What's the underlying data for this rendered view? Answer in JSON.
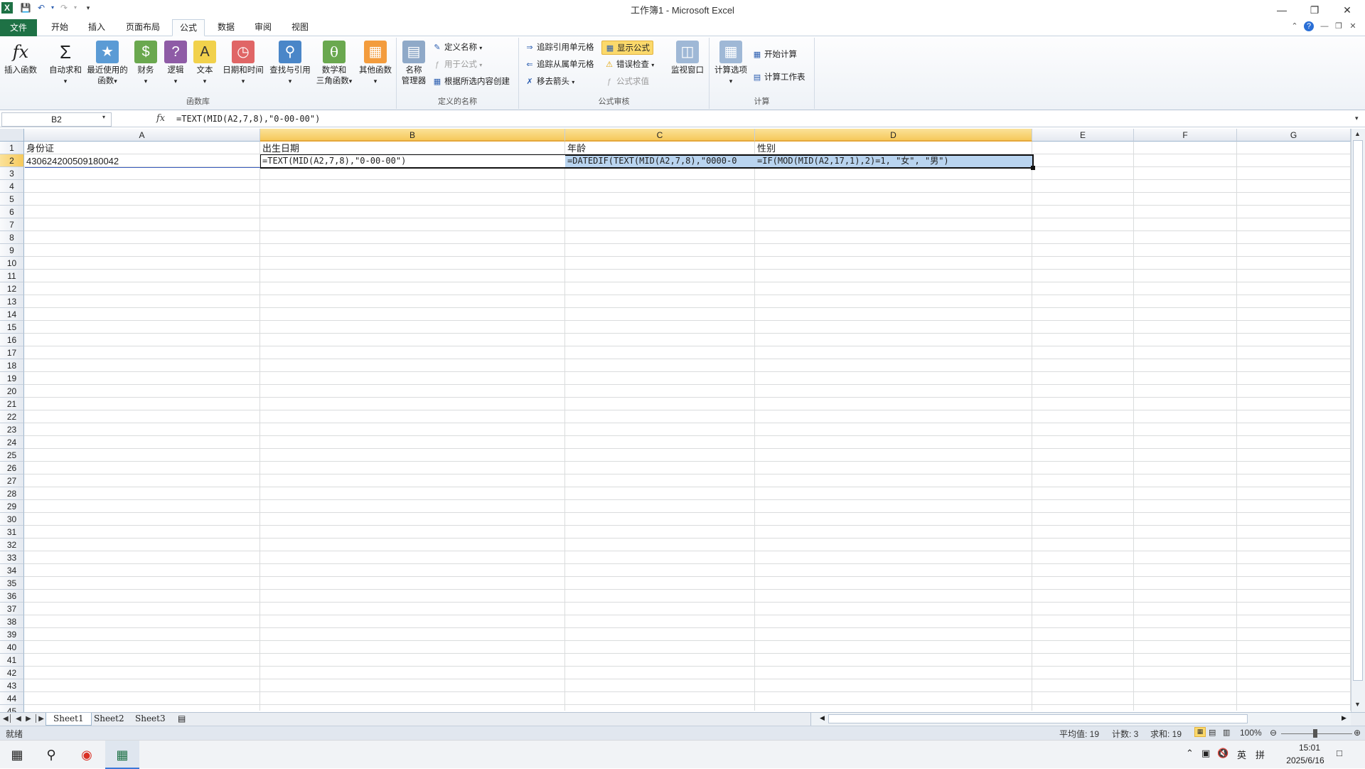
{
  "window": {
    "title": "工作簿1 - Microsoft Excel"
  },
  "tabs": [
    {
      "label": "文件"
    },
    {
      "label": "开始"
    },
    {
      "label": "插入"
    },
    {
      "label": "页面布局"
    },
    {
      "label": "公式"
    },
    {
      "label": "数据"
    },
    {
      "label": "审阅"
    },
    {
      "label": "视图"
    }
  ],
  "ribbon": {
    "function_library": {
      "label": "函数库",
      "insert_function": "插入函数",
      "autosum": "自动求和",
      "recent_1": "最近使用的",
      "recent_2": "函数",
      "financial": "财务",
      "logical": "逻辑",
      "text": "文本",
      "datetime": "日期和时间",
      "lookup": "查找与引用",
      "math_1": "数学和",
      "math_2": "三角函数",
      "more": "其他函数"
    },
    "defined_names": {
      "label": "定义的名称",
      "name_manager_1": "名称",
      "name_manager_2": "管理器",
      "define_name": "定义名称",
      "use_in_formula": "用于公式",
      "create_from_selection": "根据所选内容创建"
    },
    "formula_auditing": {
      "label": "公式审核",
      "trace_precedents": "追踪引用单元格",
      "trace_dependents": "追踪从属单元格",
      "remove_arrows": "移去箭头",
      "show_formulas": "显示公式",
      "error_checking": "错误检查",
      "evaluate_formula": "公式求值",
      "watch_window": "监视窗口"
    },
    "calculation": {
      "label": "计算",
      "options": "计算选项",
      "calc_now": "开始计算",
      "calc_sheet": "计算工作表"
    }
  },
  "formula_bar": {
    "name_box": "B2",
    "fx": "fx",
    "formula": "=TEXT(MID(A2,7,8),\"0-00-00\")"
  },
  "columns": [
    "A",
    "B",
    "C",
    "D",
    "E",
    "F",
    "G"
  ],
  "rows": [
    "1",
    "2",
    "3",
    "4",
    "5",
    "6",
    "7",
    "8",
    "9",
    "10",
    "11",
    "12",
    "13",
    "14",
    "15",
    "16",
    "17",
    "18",
    "19",
    "20",
    "21",
    "22",
    "23",
    "24",
    "25",
    "26",
    "27",
    "28",
    "29",
    "30",
    "31",
    "32",
    "33",
    "34",
    "35",
    "36",
    "37",
    "38",
    "39",
    "40",
    "41",
    "42",
    "43",
    "44",
    "45"
  ],
  "cells": {
    "A1": "身份证",
    "B1": "出生日期",
    "C1": "年龄",
    "D1": "性别",
    "A2": "430624200509180042",
    "B2": "=TEXT(MID(A2,7,8),\"0-00-00\")",
    "C2": "=DATEDIF(TEXT(MID(A2,7,8),\"0000-0",
    "D2": "=IF(MOD(MID(A2,17,1),2)=1, \"女\", \"男\")"
  },
  "sheets": [
    "Sheet1",
    "Sheet2",
    "Sheet3"
  ],
  "status": {
    "mode": "就绪",
    "average": "平均值: 19",
    "count": "计数: 3",
    "sum": "求和: 19",
    "zoom": "100%"
  },
  "taskbar": {
    "ime_1": "英",
    "ime_2": "拼",
    "time": "15:01",
    "date": "2025/6/16"
  }
}
